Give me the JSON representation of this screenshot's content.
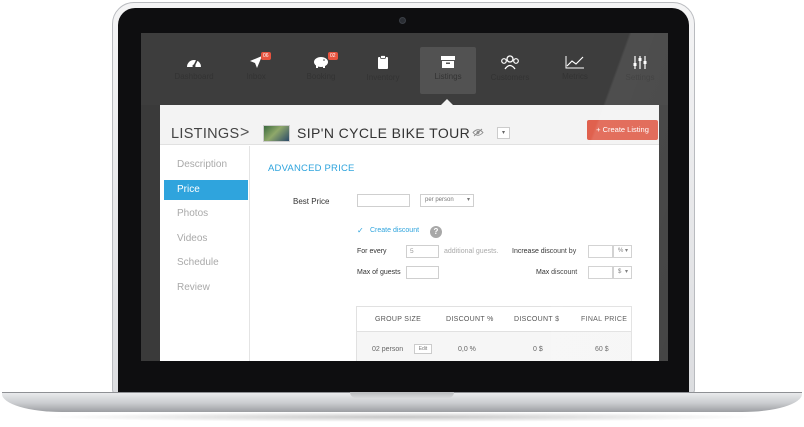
{
  "nav": {
    "items": [
      {
        "label": "Dashboard",
        "icon": "gauge-icon"
      },
      {
        "label": "Inbox",
        "icon": "paper-plane-icon",
        "badge": "06"
      },
      {
        "label": "Booking",
        "icon": "piggy-bank-icon",
        "badge": "02"
      },
      {
        "label": "Inventory",
        "icon": "clipboard-icon"
      },
      {
        "label": "Listings",
        "icon": "archive-box-icon",
        "active": true
      },
      {
        "label": "Customers",
        "icon": "people-icon"
      },
      {
        "label": "Metrics",
        "icon": "line-chart-icon"
      },
      {
        "label": "Settings",
        "icon": "sliders-icon"
      }
    ]
  },
  "header": {
    "breadcrumb": "LISTINGS",
    "separator": ">",
    "tour_title": "SIP'N CYCLE BIKE TOUR",
    "create_button": "+ Create Listing"
  },
  "sidebar": {
    "items": [
      {
        "label": "Description"
      },
      {
        "label": "Price",
        "active": true
      },
      {
        "label": "Photos"
      },
      {
        "label": "Videos"
      },
      {
        "label": "Schedule"
      },
      {
        "label": "Review"
      }
    ]
  },
  "price": {
    "section_title": "ADVANCED PRICE",
    "best_price_label": "Best Price",
    "best_price_value": "",
    "unit_select": "per person",
    "create_discount_label": "Create discount",
    "for_every_label": "For every",
    "for_every_placeholder": "5",
    "additional_guests_label": "additional guests.",
    "increase_discount_label": "Increase discount by",
    "increase_unit": "%",
    "max_guests_label": "Max of guests",
    "max_discount_label": "Max discount",
    "max_discount_unit": "$"
  },
  "table": {
    "headers": [
      "GROUP SIZE",
      "DISCOUNT %",
      "DISCOUNT $",
      "FINAL PRICE"
    ],
    "rows": [
      {
        "group_size": "02 person",
        "edit_label": "Edit",
        "discount_pct": "0,0 %",
        "discount_usd": "0 $",
        "final_price": "60 $"
      }
    ]
  },
  "colors": {
    "accent": "#2fa4dd",
    "create_button": "#e0614e",
    "nav_bg": "#3d3d3d",
    "badge": "#e8533f"
  }
}
